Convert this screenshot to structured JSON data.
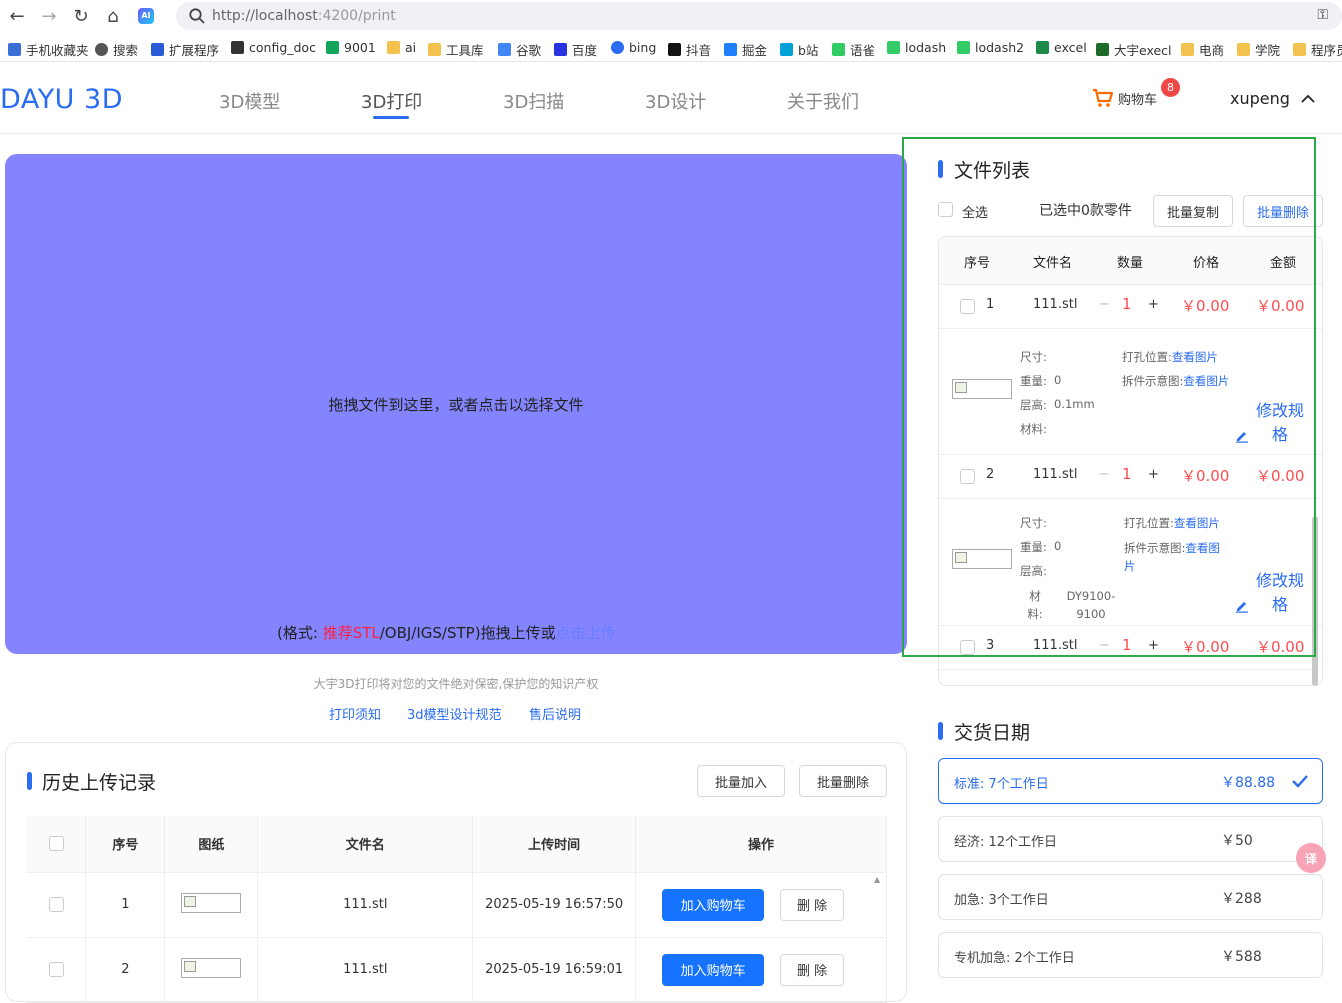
{
  "browser": {
    "url_host": "http://localhost",
    "url_path": ":4200/print",
    "bookmarks": [
      {
        "label": "手机收藏夹",
        "icon": "phone-icon"
      },
      {
        "label": "搜索",
        "icon": "globe-icon"
      },
      {
        "label": "扩展程序",
        "icon": "puzzle-icon"
      },
      {
        "label": "config_doc",
        "icon": "config-icon"
      },
      {
        "label": "9001",
        "icon": "leaf-icon"
      },
      {
        "label": "ai",
        "icon": "folder-icon"
      },
      {
        "label": "工具库",
        "icon": "folder-icon"
      },
      {
        "label": "谷歌",
        "icon": "google-icon"
      },
      {
        "label": "百度",
        "icon": "baidu-icon"
      },
      {
        "label": "bing",
        "icon": "search-icon"
      },
      {
        "label": "抖音",
        "icon": "tiktok-icon"
      },
      {
        "label": "掘金",
        "icon": "juejin-icon"
      },
      {
        "label": "b站",
        "icon": "bilibili-icon"
      },
      {
        "label": "语雀",
        "icon": "yuque-icon"
      },
      {
        "label": "lodash",
        "icon": "yuque-icon"
      },
      {
        "label": "lodash2",
        "icon": "yuque-icon"
      },
      {
        "label": "excel",
        "icon": "excel-icon"
      },
      {
        "label": "大宇execl",
        "icon": "sheet-icon"
      },
      {
        "label": "电商",
        "icon": "folder-icon"
      },
      {
        "label": "学院",
        "icon": "folder-icon"
      },
      {
        "label": "程序员",
        "icon": "folder-icon"
      }
    ]
  },
  "header": {
    "logo": "DAYU 3D",
    "nav": [
      "3D模型",
      "3D打印",
      "3D扫描",
      "3D设计",
      "关于我们"
    ],
    "active_nav": "3D打印",
    "cart_label": "购物车",
    "cart_count": "8",
    "username": "xupeng"
  },
  "upload": {
    "drop_text": "拖拽文件到这里，或者点击以选择文件",
    "format_prefix": "(格式: ",
    "format_recommend": "推荐STL",
    "format_rest": "/OBJ/IGS/STP)拖拽上传或",
    "format_link": "点击上传",
    "privacy": "大宇3D打印将对您的文件绝对保密,保护您的知识产权",
    "links": [
      "打印须知",
      "3d模型设计规范",
      "售后说明"
    ]
  },
  "history": {
    "title": "历史上传记录",
    "batch_add": "批量加入",
    "batch_delete": "批量删除",
    "columns": [
      "序号",
      "图纸",
      "文件名",
      "上传时间",
      "操作"
    ],
    "rows": [
      {
        "index": "1",
        "filename": "111.stl",
        "time": "2025-05-19 16:57:50",
        "add": "加入购物车",
        "delete": "删 除"
      },
      {
        "index": "2",
        "filename": "111.stl",
        "time": "2025-05-19 16:59:01",
        "add": "加入购物车",
        "delete": "删 除"
      }
    ]
  },
  "filelist": {
    "title": "文件列表",
    "select_all": "全选",
    "selected_info": "已选中0款零件",
    "batch_copy": "批量复制",
    "batch_delete": "批量删除",
    "columns": [
      "序号",
      "文件名",
      "数量",
      "价格",
      "金额"
    ],
    "items": [
      {
        "index": "1",
        "name": "111.stl",
        "qty": "1",
        "price": "￥0.00",
        "amount": "￥0.00",
        "size_label": "尺寸:",
        "weight_label": "重量:",
        "weight": "0",
        "layer_label": "层高:",
        "layer": "0.1mm",
        "material_label": "材料:",
        "material": "",
        "hole_label": "打孔位置:",
        "hole_link": "查看图片",
        "split_label": "拆件示意图:",
        "split_link": "查看图片",
        "modify": "修改规格"
      },
      {
        "index": "2",
        "name": "111.stl",
        "qty": "1",
        "price": "￥0.00",
        "amount": "￥0.00",
        "size_label": "尺寸:",
        "weight_label": "重量:",
        "weight": "0",
        "layer_label": "层高:",
        "layer": "",
        "material_label": "材料:",
        "material": "DY9100-9100",
        "hole_label": "打孔位置:",
        "hole_link": "查看图片",
        "split_label": "拆件示意图:",
        "split_link": "查看图片",
        "modify": "修改规格"
      },
      {
        "index": "3",
        "name": "111.stl",
        "qty": "1",
        "price": "￥0.00",
        "amount": "￥0.00"
      }
    ],
    "minus": "−",
    "plus": "+"
  },
  "delivery": {
    "title": "交货日期",
    "options": [
      {
        "label": "标准: 7个工作日",
        "price": "￥88.88",
        "selected": true
      },
      {
        "label": "经济: 12个工作日",
        "price": "￥50",
        "selected": false
      },
      {
        "label": "加急: 3个工作日",
        "price": "￥288",
        "selected": false
      },
      {
        "label": "专机加急: 2个工作日",
        "price": "￥588",
        "selected": false
      }
    ]
  },
  "colors": {
    "accent": "#2a6cf2",
    "dropzone": "#8484ff",
    "price": "#ff4d4f",
    "highlight_border": "#2aa84a",
    "badge": "#f04747"
  }
}
